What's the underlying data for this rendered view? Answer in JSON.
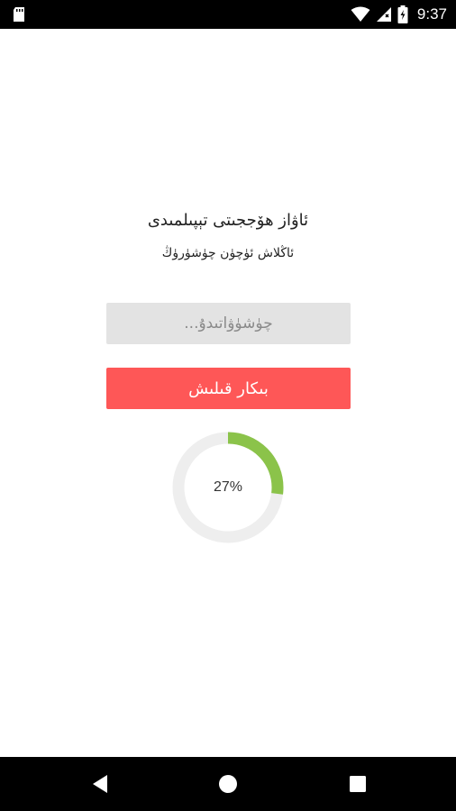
{
  "status_bar": {
    "time": "9:37",
    "icons": [
      "sd-card-icon",
      "wifi-icon",
      "signal-icon",
      "battery-icon"
    ]
  },
  "main": {
    "title": "ئاۋاز ھۆججىتى تېپىلمىدى",
    "subtitle": "ئاڭلاش ئۈچۈن چۈشۈرۈڭ",
    "download_input": {
      "placeholder": "چۈشۈۋاتىدۇ..."
    },
    "action_button_label": "بىكار قىلىش",
    "progress": {
      "label": "27%",
      "value": 0.27,
      "color": "#8bc34a",
      "track_color": "#eeeeee"
    }
  },
  "nav_bar": {
    "buttons": [
      "back-icon",
      "home-icon",
      "recents-icon"
    ]
  },
  "colors": {
    "accent": "#fe5757",
    "progress": "#8bc34a",
    "input_bg": "#e3e3e3"
  }
}
